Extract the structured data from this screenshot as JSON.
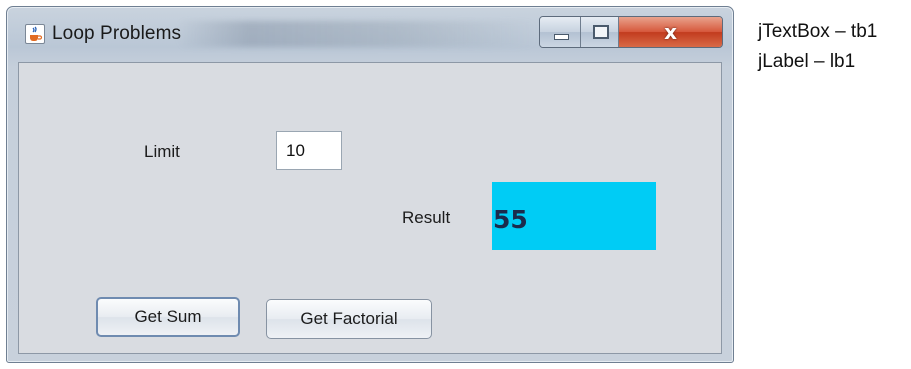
{
  "window": {
    "title": "Loop Problems",
    "controls": {
      "minimize": "minimize",
      "maximize": "maximize",
      "close": "x"
    }
  },
  "form": {
    "limit_label": "Limit",
    "limit_value": "10",
    "result_label": "Result",
    "result_value": "55",
    "result_bg_color": "#00ccf5"
  },
  "buttons": {
    "get_sum": "Get Sum",
    "get_factorial": "Get Factorial"
  },
  "notes": {
    "line1": "jTextBox – tb1",
    "line2": "jLabel – lb1"
  },
  "icons": {
    "app": "java-cup-icon",
    "minimize": "minimize-icon",
    "maximize": "maximize-icon",
    "close": "close-icon"
  }
}
